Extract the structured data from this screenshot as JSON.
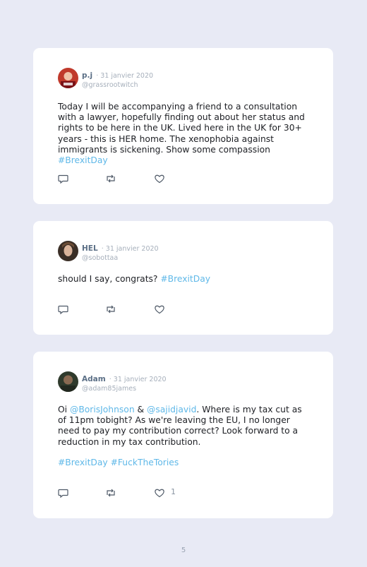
{
  "tweets": [
    {
      "author": "p.j",
      "date": "· 31 janvier 2020",
      "handle": "@grassrootwitch",
      "text": "Today I will be accompanying a friend to a consultation with a lawyer, hopefully finding out about her status and rights to be here in the UK. Lived here in the UK for 30+ years - this is HER home. The xenophobia against immigrants is sickening. Show some compassion ",
      "hashtag": "#BrexitDay",
      "avatar_color": "#b8202c"
    },
    {
      "author": "HEL",
      "date": "· 31 janvier 2020",
      "handle": "@sobottaa",
      "text": "should I say, congrats? ",
      "hashtag": "#BrexitDay",
      "avatar_color": "#5a4a3c"
    },
    {
      "author": "Adam",
      "date": "· 31 janvier 2020",
      "handle": "@adam85james",
      "text_prefix": "Oi ",
      "mention1": "@BorisJohnson",
      "text_mid": " & ",
      "mention2": "@sajidjavid",
      "text_rest": ". Where is my tax cut as of 11pm tobight? As we're leaving the EU, I no longer need to pay my contribution correct? Look forward to a reduction in my tax contribution.",
      "hashtag1": "#BrexitDay",
      "hashtag_sep": " ",
      "hashtag2": "#FuckTheTories",
      "like_count": "1",
      "avatar_color": "#3d4a38"
    }
  ],
  "icons": [
    "reply-icon",
    "retweet-icon",
    "heart-icon"
  ],
  "colors": {
    "background": "#e8eaf5",
    "card": "#ffffff",
    "link": "#5fb8e8",
    "name": "#5b6f86",
    "meta": "#a6afbb"
  },
  "page_number": "5"
}
